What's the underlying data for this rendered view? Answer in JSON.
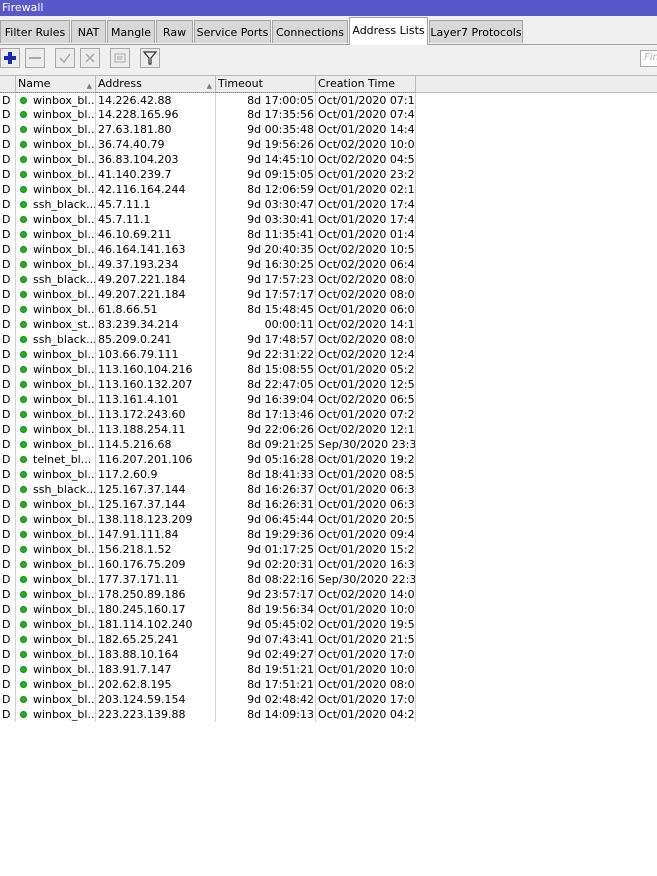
{
  "window": {
    "title": "Firewall"
  },
  "tabs": [
    {
      "label": "Filter Rules",
      "active": false
    },
    {
      "label": "NAT",
      "active": false
    },
    {
      "label": "Mangle",
      "active": false
    },
    {
      "label": "Raw",
      "active": false
    },
    {
      "label": "Service Ports",
      "active": false
    },
    {
      "label": "Connections",
      "active": false
    },
    {
      "label": "Address Lists",
      "active": true
    },
    {
      "label": "Layer7 Protocols",
      "active": false
    }
  ],
  "toolbar": {
    "buttons": [
      {
        "name": "add-button",
        "icon": "plus-icon",
        "enabled": true
      },
      {
        "name": "remove-button",
        "icon": "minus-icon",
        "enabled": false
      },
      {
        "name": "enable-button",
        "icon": "check-icon",
        "enabled": false
      },
      {
        "name": "disable-button",
        "icon": "x-icon",
        "enabled": false
      },
      {
        "name": "comment-button",
        "icon": "comment-icon",
        "enabled": false
      },
      {
        "name": "filter-button",
        "icon": "filter-icon",
        "enabled": true
      }
    ],
    "find_placeholder": "Find"
  },
  "table": {
    "columns": [
      "",
      "Name",
      "Address",
      "Timeout",
      "Creation Time"
    ],
    "status_color": "#22b024",
    "rows": [
      {
        "flag": "D",
        "name": "winbox_bl...",
        "address": "14.226.42.88",
        "timeout": "8d 17:00:05",
        "created": "Oct/01/2020 07:1..."
      },
      {
        "flag": "D",
        "name": "winbox_bl...",
        "address": "14.228.165.96",
        "timeout": "8d 17:35:56",
        "created": "Oct/01/2020 07:4..."
      },
      {
        "flag": "D",
        "name": "winbox_bl...",
        "address": "27.63.181.80",
        "timeout": "9d 00:35:48",
        "created": "Oct/01/2020 14:4..."
      },
      {
        "flag": "D",
        "name": "winbox_bl...",
        "address": "36.74.40.79",
        "timeout": "9d 19:56:26",
        "created": "Oct/02/2020 10:0..."
      },
      {
        "flag": "D",
        "name": "winbox_bl...",
        "address": "36.83.104.203",
        "timeout": "9d 14:45:10",
        "created": "Oct/02/2020 04:5..."
      },
      {
        "flag": "D",
        "name": "winbox_bl...",
        "address": "41.140.239.7",
        "timeout": "9d 09:15:05",
        "created": "Oct/01/2020 23:2..."
      },
      {
        "flag": "D",
        "name": "winbox_bl...",
        "address": "42.116.164.244",
        "timeout": "8d 12:06:59",
        "created": "Oct/01/2020 02:1..."
      },
      {
        "flag": "D",
        "name": "ssh_black...",
        "address": "45.7.11.1",
        "timeout": "9d 03:30:47",
        "created": "Oct/01/2020 17:4..."
      },
      {
        "flag": "D",
        "name": "winbox_bl...",
        "address": "45.7.11.1",
        "timeout": "9d 03:30:41",
        "created": "Oct/01/2020 17:4..."
      },
      {
        "flag": "D",
        "name": "winbox_bl...",
        "address": "46.10.69.211",
        "timeout": "8d 11:35:41",
        "created": "Oct/01/2020 01:4..."
      },
      {
        "flag": "D",
        "name": "winbox_bl...",
        "address": "46.164.141.163",
        "timeout": "9d 20:40:35",
        "created": "Oct/02/2020 10:5..."
      },
      {
        "flag": "D",
        "name": "winbox_bl...",
        "address": "49.37.193.234",
        "timeout": "9d 16:30:25",
        "created": "Oct/02/2020 06:4..."
      },
      {
        "flag": "D",
        "name": "ssh_black...",
        "address": "49.207.221.184",
        "timeout": "9d 17:57:23",
        "created": "Oct/02/2020 08:0..."
      },
      {
        "flag": "D",
        "name": "winbox_bl...",
        "address": "49.207.221.184",
        "timeout": "9d 17:57:17",
        "created": "Oct/02/2020 08:0..."
      },
      {
        "flag": "D",
        "name": "winbox_bl...",
        "address": "61.8.66.51",
        "timeout": "8d 15:48:45",
        "created": "Oct/01/2020 06:0..."
      },
      {
        "flag": "D",
        "name": "winbox_st...",
        "address": "83.239.34.214",
        "timeout": "00:00:11",
        "created": "Oct/02/2020 14:1..."
      },
      {
        "flag": "D",
        "name": "ssh_black...",
        "address": "85.209.0.241",
        "timeout": "9d 17:48:57",
        "created": "Oct/02/2020 08:0..."
      },
      {
        "flag": "D",
        "name": "winbox_bl...",
        "address": "103.66.79.111",
        "timeout": "9d 22:31:22",
        "created": "Oct/02/2020 12:4..."
      },
      {
        "flag": "D",
        "name": "winbox_bl...",
        "address": "113.160.104.216",
        "timeout": "8d 15:08:55",
        "created": "Oct/01/2020 05:2..."
      },
      {
        "flag": "D",
        "name": "winbox_bl...",
        "address": "113.160.132.207",
        "timeout": "8d 22:47:05",
        "created": "Oct/01/2020 12:5..."
      },
      {
        "flag": "D",
        "name": "winbox_bl...",
        "address": "113.161.4.101",
        "timeout": "9d 16:39:04",
        "created": "Oct/02/2020 06:5..."
      },
      {
        "flag": "D",
        "name": "winbox_bl...",
        "address": "113.172.243.60",
        "timeout": "8d 17:13:46",
        "created": "Oct/01/2020 07:2..."
      },
      {
        "flag": "D",
        "name": "winbox_bl...",
        "address": "113.188.254.11",
        "timeout": "9d 22:06:26",
        "created": "Oct/02/2020 12:1..."
      },
      {
        "flag": "D",
        "name": "winbox_bl...",
        "address": "114.5.216.68",
        "timeout": "8d 09:21:25",
        "created": "Sep/30/2020 23:3..."
      },
      {
        "flag": "D",
        "name": "telnet_bl...",
        "address": "116.207.201.106",
        "timeout": "9d 05:16:28",
        "created": "Oct/01/2020 19:2..."
      },
      {
        "flag": "D",
        "name": "winbox_bl...",
        "address": "117.2.60.9",
        "timeout": "8d 18:41:33",
        "created": "Oct/01/2020 08:5..."
      },
      {
        "flag": "D",
        "name": "ssh_black...",
        "address": "125.167.37.144",
        "timeout": "8d 16:26:37",
        "created": "Oct/01/2020 06:3..."
      },
      {
        "flag": "D",
        "name": "winbox_bl...",
        "address": "125.167.37.144",
        "timeout": "8d 16:26:31",
        "created": "Oct/01/2020 06:3..."
      },
      {
        "flag": "D",
        "name": "winbox_bl...",
        "address": "138.118.123.209",
        "timeout": "9d 06:45:44",
        "created": "Oct/01/2020 20:5..."
      },
      {
        "flag": "D",
        "name": "winbox_bl...",
        "address": "147.91.111.84",
        "timeout": "8d 19:29:36",
        "created": "Oct/01/2020 09:4..."
      },
      {
        "flag": "D",
        "name": "winbox_bl...",
        "address": "156.218.1.52",
        "timeout": "9d 01:17:25",
        "created": "Oct/01/2020 15:2..."
      },
      {
        "flag": "D",
        "name": "winbox_bl...",
        "address": "160.176.75.209",
        "timeout": "9d 02:20:31",
        "created": "Oct/01/2020 16:3..."
      },
      {
        "flag": "D",
        "name": "winbox_bl...",
        "address": "177.37.171.11",
        "timeout": "8d 08:22:16",
        "created": "Sep/30/2020 22:3..."
      },
      {
        "flag": "D",
        "name": "winbox_bl...",
        "address": "178.250.89.186",
        "timeout": "9d 23:57:17",
        "created": "Oct/02/2020 14:0..."
      },
      {
        "flag": "D",
        "name": "winbox_bl...",
        "address": "180.245.160.17",
        "timeout": "8d 19:56:34",
        "created": "Oct/01/2020 10:0..."
      },
      {
        "flag": "D",
        "name": "winbox_bl...",
        "address": "181.114.102.240",
        "timeout": "9d 05:45:02",
        "created": "Oct/01/2020 19:5..."
      },
      {
        "flag": "D",
        "name": "winbox_bl...",
        "address": "182.65.25.241",
        "timeout": "9d 07:43:41",
        "created": "Oct/01/2020 21:5..."
      },
      {
        "flag": "D",
        "name": "winbox_bl...",
        "address": "183.88.10.164",
        "timeout": "9d 02:49:27",
        "created": "Oct/01/2020 17:0..."
      },
      {
        "flag": "D",
        "name": "winbox_bl...",
        "address": "183.91.7.147",
        "timeout": "8d 19:51:21",
        "created": "Oct/01/2020 10:0..."
      },
      {
        "flag": "D",
        "name": "winbox_bl...",
        "address": "202.62.8.195",
        "timeout": "8d 17:51:21",
        "created": "Oct/01/2020 08:0..."
      },
      {
        "flag": "D",
        "name": "winbox_bl...",
        "address": "203.124.59.154",
        "timeout": "9d 02:48:42",
        "created": "Oct/01/2020 17:0..."
      },
      {
        "flag": "D",
        "name": "winbox_bl...",
        "address": "223.223.139.88",
        "timeout": "8d 14:09:13",
        "created": "Oct/01/2020 04:2..."
      }
    ]
  }
}
